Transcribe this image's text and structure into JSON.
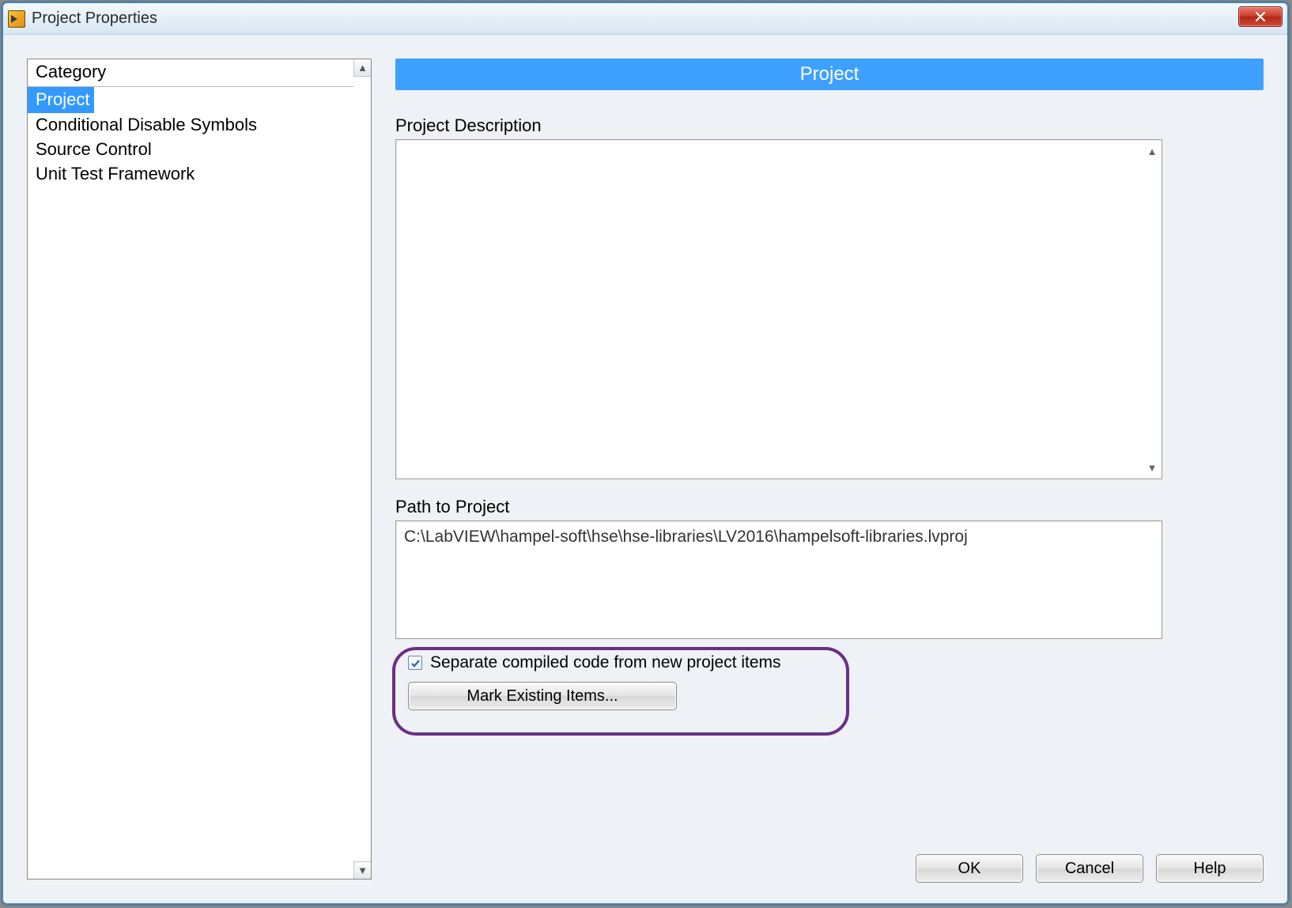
{
  "window": {
    "title": "Project Properties"
  },
  "sidebar": {
    "header": "Category",
    "items": [
      "Project",
      "Conditional Disable Symbols",
      "Source Control",
      "Unit Test Framework"
    ],
    "selected_index": 0
  },
  "main": {
    "page_title": "Project",
    "description_label": "Project Description",
    "description_value": "",
    "path_label": "Path to Project",
    "path_value": "C:\\LabVIEW\\hampel-soft\\hse\\hse-libraries\\LV2016\\hampelsoft-libraries.lvproj",
    "separate_compiled": {
      "checked": true,
      "label": "Separate compiled code from new project items"
    },
    "mark_button": "Mark Existing Items..."
  },
  "buttons": {
    "ok": "OK",
    "cancel": "Cancel",
    "help": "Help"
  }
}
